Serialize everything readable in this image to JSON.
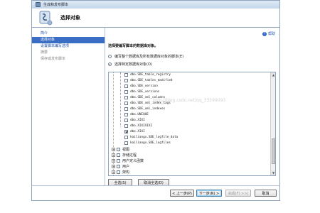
{
  "window": {
    "title": "生成和发布脚本"
  },
  "header": {
    "title": "选择对象"
  },
  "sidebar": {
    "items": [
      {
        "label": "简介",
        "state": "link"
      },
      {
        "label": "选择对象",
        "state": "selected"
      },
      {
        "label": "设置脚本编写选项",
        "state": "link"
      },
      {
        "label": "摘要",
        "state": "disabled"
      },
      {
        "label": "保存或发布脚本",
        "state": "disabled"
      }
    ]
  },
  "main": {
    "help_label": "帮助",
    "section_title": "选择要编写脚本的数据库对象。",
    "radio_all": "编写整个数据库及所有数据库对象的脚本(E)",
    "radio_specific": "选择特定数据库对象(O)",
    "watermark": "http://blog.csdn.net/qq_33599093"
  },
  "tree": {
    "items": [
      {
        "label": "dbo.SDE_table_registry",
        "checked": false
      },
      {
        "label": "dbo.SDE_tables_modified",
        "checked": false
      },
      {
        "label": "dbo.SDE_version",
        "checked": false
      },
      {
        "label": "dbo.SDE_versions",
        "checked": false
      },
      {
        "label": "dbo.SDE_xml_columns",
        "checked": false
      },
      {
        "label": "dbo.SDE_xml_index_tags",
        "checked": false
      },
      {
        "label": "dbo.SDE_xml_indexes",
        "checked": false
      },
      {
        "label": "dbo.UNIQUE",
        "checked": false
      },
      {
        "label": "dbo.XIXI",
        "checked": false
      },
      {
        "label": "dbo.XIXIXIXI",
        "checked": false
      },
      {
        "label": "dbo.XIXI",
        "checked": true
      },
      {
        "label": "kailiangx.SDE_logfile_data",
        "checked": false
      },
      {
        "label": "kailiangx.SDE_logfiles",
        "checked": false
      }
    ],
    "categories": [
      {
        "label": "视图"
      },
      {
        "label": "存储过程"
      },
      {
        "label": "用户定义函数"
      },
      {
        "label": "用户"
      },
      {
        "label": "架构"
      }
    ]
  },
  "buttons": {
    "select_all": "全选(S)",
    "deselect_all": "取消全选(D)",
    "prev": "< 上一步(P)",
    "next": "下一步(N) >",
    "finish": "完成(F) >>|",
    "cancel": "取消"
  }
}
